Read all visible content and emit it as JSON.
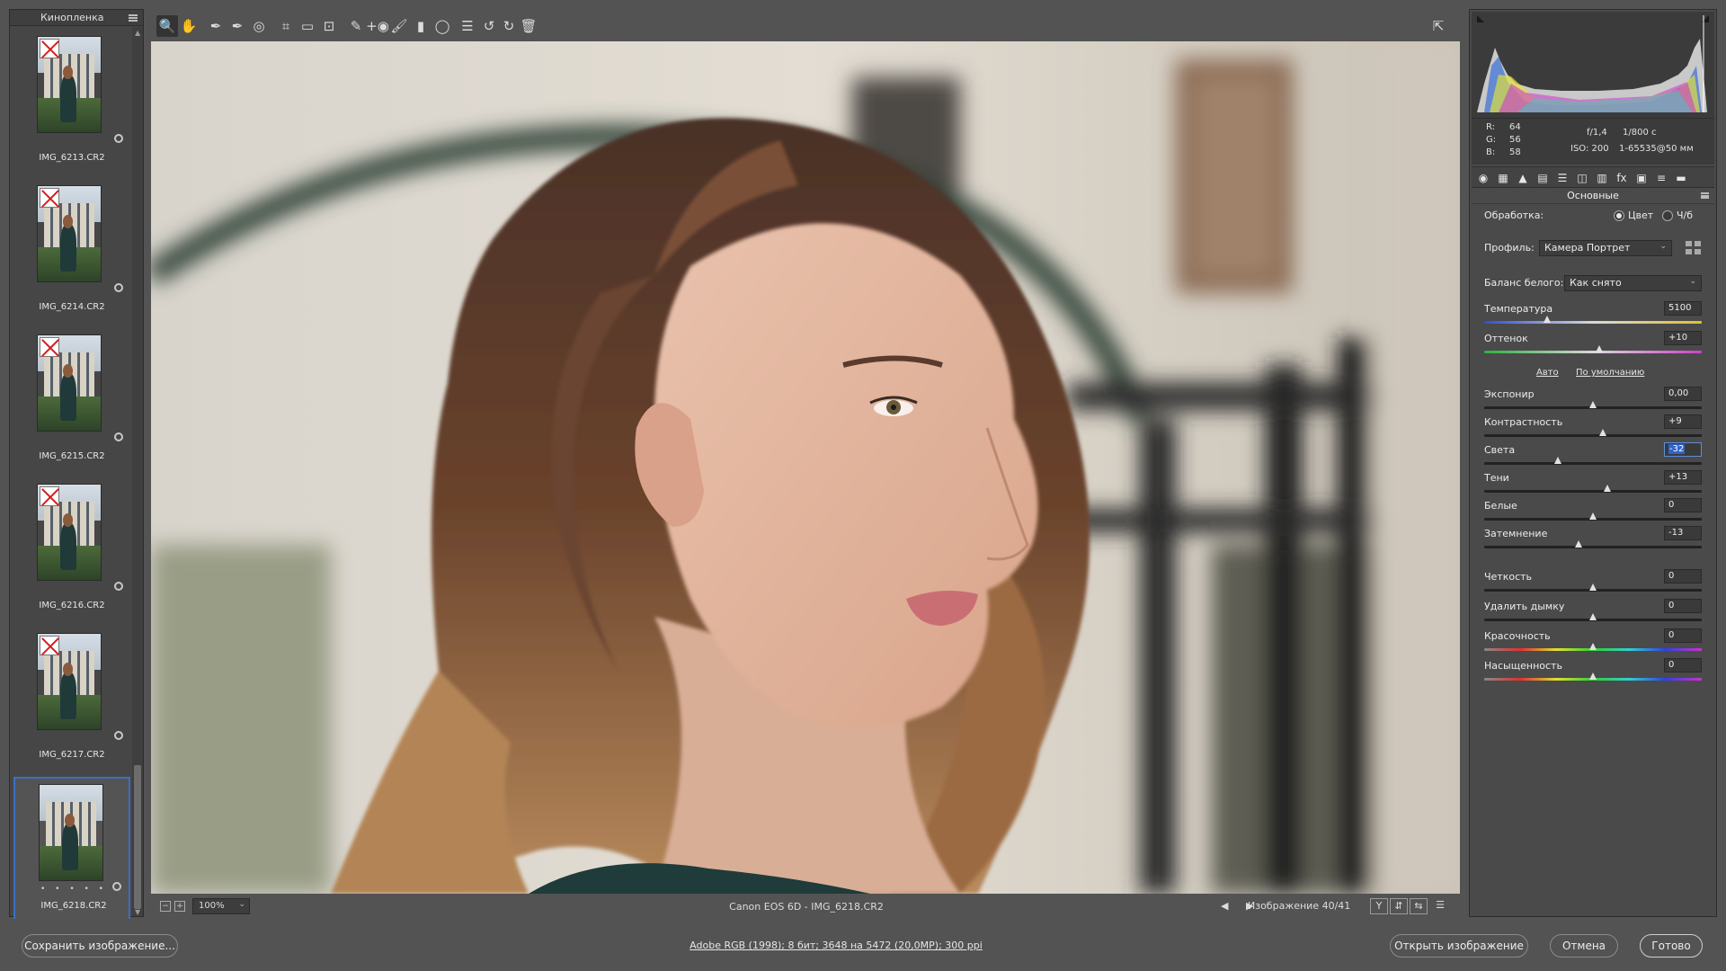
{
  "filmstrip": {
    "title": "Кинопленка",
    "items": [
      {
        "label": "IMG_6213.CR2",
        "rejected": true,
        "selected": false
      },
      {
        "label": "IMG_6214.CR2",
        "rejected": true,
        "selected": false
      },
      {
        "label": "IMG_6215.CR2",
        "rejected": true,
        "selected": false
      },
      {
        "label": "IMG_6216.CR2",
        "rejected": true,
        "selected": false
      },
      {
        "label": "IMG_6217.CR2",
        "rejected": true,
        "selected": false
      },
      {
        "label": "IMG_6218.CR2",
        "rejected": false,
        "selected": true,
        "stars": "• • • • •"
      }
    ]
  },
  "toolbar": {
    "tools": [
      {
        "name": "zoom-tool",
        "glyph": "🔍"
      },
      {
        "name": "hand-tool",
        "glyph": "✋"
      },
      {
        "name": "white-balance-tool",
        "glyph": "✒"
      },
      {
        "name": "color-sampler-tool",
        "glyph": "✒"
      },
      {
        "name": "targeted-adjustment-tool",
        "glyph": "◎"
      },
      {
        "name": "crop-tool",
        "glyph": "⌗"
      },
      {
        "name": "straighten-tool",
        "glyph": "▭"
      },
      {
        "name": "transform-tool",
        "glyph": "⊡"
      },
      {
        "name": "spot-removal-tool",
        "glyph": "✎"
      },
      {
        "name": "red-eye-tool",
        "glyph": "+◉"
      },
      {
        "name": "adjustment-brush-tool",
        "glyph": "🖌"
      },
      {
        "name": "graduated-filter-tool",
        "glyph": "▮"
      },
      {
        "name": "radial-filter-tool",
        "glyph": "◯"
      },
      {
        "name": "preferences-tool",
        "glyph": "☰"
      },
      {
        "name": "rotate-left-tool",
        "glyph": "↺"
      },
      {
        "name": "rotate-right-tool",
        "glyph": "↻"
      },
      {
        "name": "delete-tool",
        "glyph": "🗑"
      }
    ],
    "fullscreen_glyph": "⇱"
  },
  "status": {
    "zoom_minus": "−",
    "zoom_plus": "+",
    "zoom_value": "100%",
    "camera_file": "Canon EOS 6D  -  IMG_6218.CR2",
    "nav": "◀ ▶",
    "image_count": "Изображение 40/41",
    "view_buttons": [
      "Y",
      "⇵",
      "⇆",
      "☰"
    ]
  },
  "histogram": {
    "r_label": "R:",
    "r": "64",
    "g_label": "G:",
    "g": "56",
    "b_label": "B:",
    "b": "58",
    "aperture": "f/1,4",
    "shutter": "1/800 с",
    "iso": "ISO: 200",
    "lens": "1-65535@50 мм"
  },
  "panel": {
    "tab_icons": [
      "◉",
      "▦",
      "▲",
      "▤",
      "☰",
      "◫",
      "▥",
      "fx",
      "▣",
      "≡",
      "▬"
    ],
    "section_title": "Основные",
    "treatment_label": "Обработка:",
    "treatment_color": "Цвет",
    "treatment_bw": "Ч/б",
    "profile_label": "Профиль:",
    "profile_value": "Камера Портрет",
    "wb_label": "Баланс белого:",
    "wb_value": "Как снято",
    "auto_link": "Авто",
    "default_link": "По умолчанию",
    "sliders": [
      {
        "key": "temperature",
        "label": "Температура",
        "value": "5100",
        "pos": 0.29,
        "track": "temp"
      },
      {
        "key": "tint",
        "label": "Оттенок",
        "value": "+10",
        "pos": 0.53,
        "track": "tint"
      },
      {
        "key": "exposure",
        "label": "Экспонир",
        "value": "0,00",
        "pos": 0.5,
        "track": "gray"
      },
      {
        "key": "contrast",
        "label": "Контрастность",
        "value": "+9",
        "pos": 0.545,
        "track": "gray"
      },
      {
        "key": "highlights",
        "label": "Света",
        "value": "-32",
        "pos": 0.34,
        "track": "gray",
        "focused": true
      },
      {
        "key": "shadows",
        "label": "Тени",
        "value": "+13",
        "pos": 0.565,
        "track": "gray"
      },
      {
        "key": "whites",
        "label": "Белые",
        "value": "0",
        "pos": 0.5,
        "track": "gray"
      },
      {
        "key": "blacks",
        "label": "Затемнение",
        "value": "-13",
        "pos": 0.435,
        "track": "gray"
      },
      {
        "key": "clarity",
        "label": "Четкость",
        "value": "0",
        "pos": 0.5,
        "track": "gray"
      },
      {
        "key": "dehaze",
        "label": "Удалить дымку",
        "value": "0",
        "pos": 0.5,
        "track": "gray"
      },
      {
        "key": "vibrance",
        "label": "Красочность",
        "value": "0",
        "pos": 0.5,
        "track": "rainbow"
      },
      {
        "key": "saturation",
        "label": "Насыщенность",
        "value": "0",
        "pos": 0.5,
        "track": "rainbow"
      }
    ]
  },
  "bottom": {
    "save_label": "Сохранить изображение...",
    "workflow_label": "Adobe RGB (1998); 8 бит; 3648 на 5472 (20,0MP); 300 ppi",
    "open_label": "Открыть изображение",
    "cancel_label": "Отмена",
    "done_label": "Готово"
  },
  "colors": {
    "accent": "#3d6ec5",
    "panel": "#4a4a4a",
    "background": "#535353"
  }
}
